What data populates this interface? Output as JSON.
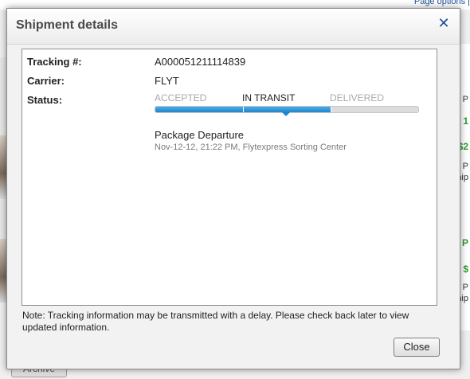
{
  "background": {
    "top_link": "Page options |",
    "archive_button": "Archive",
    "right_snippets": [
      "P",
      "1",
      "$2",
      "P",
      "hip",
      "P",
      "$",
      "P",
      "hip"
    ]
  },
  "dialog": {
    "title": "Shipment details",
    "close_icon": "close-icon",
    "accent_color": "#1f4f99",
    "fields": {
      "tracking_label": "Tracking #:",
      "tracking_value": "A000051211114839",
      "carrier_label": "Carrier:",
      "carrier_value": "FLYT",
      "status_label": "Status:"
    },
    "status": {
      "stages": [
        "ACCEPTED",
        "IN TRANSIT",
        "DELIVERED"
      ],
      "current_stage": "IN TRANSIT",
      "progress_fraction": 0.67,
      "bar_color": "#1f86cc"
    },
    "event": {
      "title": "Package Departure",
      "detail": "Nov-12-12, 21:22 PM, Flytexpress Sorting Center"
    },
    "note": "Note: Tracking information may be transmitted with a delay. Please check back later to view updated information.",
    "close_button": "Close"
  }
}
